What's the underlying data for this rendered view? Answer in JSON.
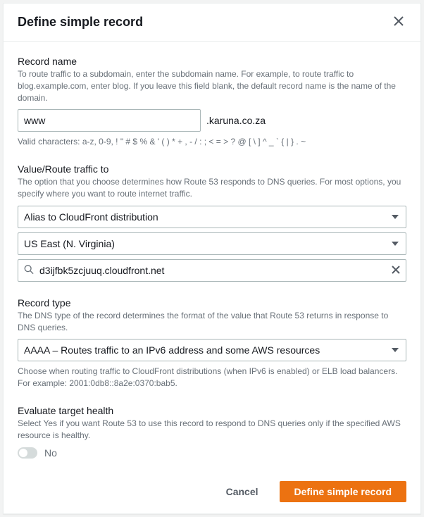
{
  "header": {
    "title": "Define simple record"
  },
  "record_name": {
    "label": "Record name",
    "desc": "To route traffic to a subdomain, enter the subdomain name. For example, to route traffic to blog.example.com, enter blog. If you leave this field blank, the default record name is the name of the domain.",
    "value": "www",
    "suffix": ".karuna.co.za",
    "hint": "Valid characters: a-z, 0-9, ! \" # $ % & ' ( ) * + , - / : ; < = > ? @ [ \\ ] ^ _ ` { | } . ~"
  },
  "route_to": {
    "label": "Value/Route traffic to",
    "desc": "The option that you choose determines how Route 53 responds to DNS queries. For most options, you specify where you want to route internet traffic.",
    "alias_value": "Alias to CloudFront distribution",
    "region_value": "US East (N. Virginia)",
    "target_value": "d3ijfbk5zcjuuq.cloudfront.net"
  },
  "record_type": {
    "label": "Record type",
    "desc": "The DNS type of the record determines the format of the value that Route 53 returns in response to DNS queries.",
    "value": "AAAA – Routes traffic to an IPv6 address and some AWS resources",
    "hint": "Choose when routing traffic to CloudFront distributions (when IPv6 is enabled) or ELB load balancers. For example: 2001:0db8::8a2e:0370:bab5."
  },
  "evaluate_health": {
    "label": "Evaluate target health",
    "desc": "Select Yes if you want Route 53 to use this record to respond to DNS queries only if the specified AWS resource is healthy.",
    "toggle_value": "No"
  },
  "footer": {
    "cancel": "Cancel",
    "submit": "Define simple record"
  }
}
